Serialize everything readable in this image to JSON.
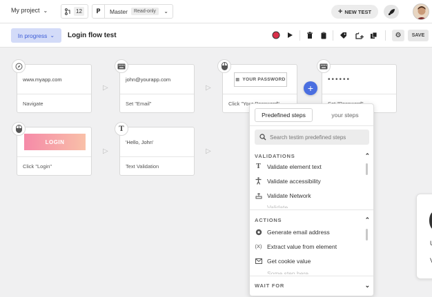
{
  "topbar": {
    "project": "My project",
    "branch_count": "12",
    "branch": "Master",
    "branch_badge": "Read-only",
    "new_test": "NEW TEST"
  },
  "subbar": {
    "status": "In progress",
    "test_name": "Login flow test",
    "save": "SAVE"
  },
  "steps": [
    {
      "top": "www.myapp.com",
      "label": "Navigate",
      "icon": "compass-icon"
    },
    {
      "top": "john@yourapp.com",
      "label": "Set \"Email\"",
      "icon": "keyboard-icon"
    },
    {
      "top": "YOUR PASSWORD",
      "label": "Click \"Your Password\"",
      "icon": "mouse-icon"
    },
    {
      "top": "••••••",
      "label": "Set \"Password\"",
      "icon": "keyboard-icon"
    },
    {
      "top": "LOGIN",
      "label": "Click \"Login\"",
      "icon": "mouse-icon"
    },
    {
      "top": "'Hello, John'",
      "label": "Text Validation",
      "icon": "text-icon"
    }
  ],
  "popover": {
    "tab_predefined": "Predefined steps",
    "tab_yours": "your steps",
    "search_placeholder": "Search testim predefined steps",
    "validations": {
      "title": "VALIDATIONS",
      "items": [
        "Validate element text",
        "Validate accessibility",
        "Validate Network"
      ],
      "cut_item": "Validate"
    },
    "actions": {
      "title": "ACTIONS",
      "items": [
        "Generate email address",
        "Extract value from element",
        "Get cookie value"
      ],
      "cut_item": "Some step here"
    },
    "wait_for": {
      "title": "WAIT FOR"
    }
  },
  "sidecard": {
    "line1": "U",
    "line2": "V"
  },
  "colors": {
    "accent": "#4a6ee0",
    "status_bg": "#d3dbf8",
    "record": "#d9304a"
  }
}
